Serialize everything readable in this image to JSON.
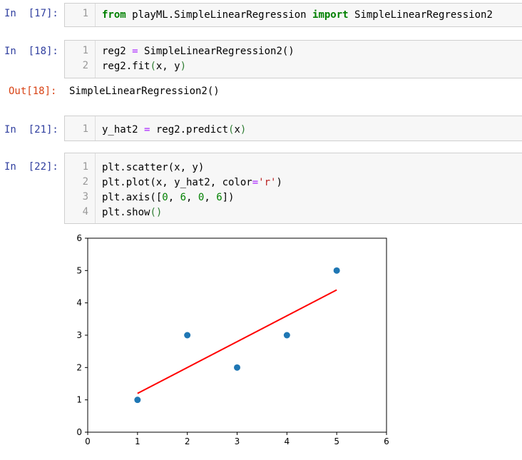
{
  "cells": [
    {
      "prompt": "In  [17]:",
      "lines": [
        {
          "n": "1"
        }
      ]
    },
    {
      "prompt": "In  [18]:",
      "lines": [
        {
          "n": "1"
        },
        {
          "n": "2"
        }
      ]
    },
    {
      "out_prompt": "Out[18]:",
      "out_text": "SimpleLinearRegression2()"
    },
    {
      "prompt": "In  [21]:",
      "lines": [
        {
          "n": "1"
        }
      ]
    },
    {
      "prompt": "In  [22]:",
      "lines": [
        {
          "n": "1"
        },
        {
          "n": "2"
        },
        {
          "n": "3"
        },
        {
          "n": "4"
        }
      ]
    }
  ],
  "code": {
    "c17": {
      "kw_from": "from",
      "module": " playML.SimpleLinearRegression ",
      "kw_import": "import",
      "name": " SimpleLinearRegression2"
    },
    "c18_l1": {
      "lhs": "reg2 ",
      "eq": "=",
      "rhs": " SimpleLinearRegression2()"
    },
    "c18_l2": {
      "text": "reg2.fit",
      "open": "(",
      "args": "x, y",
      "close": ")"
    },
    "c21": {
      "lhs": "y_hat2 ",
      "eq": "=",
      "rhs": " reg2.predict",
      "open": "(",
      "args": "x",
      "close": ")"
    },
    "c22_l1": {
      "text": "plt.scatter(x, y)"
    },
    "c22_l2": {
      "pre": "plt.plot(x, y_hat2, color",
      "eq": "=",
      "str": "'r'",
      "close": ")"
    },
    "c22_l3": {
      "pre": "plt.axis([",
      "n0": "0",
      "c1": ", ",
      "n6a": "6",
      "c2": ", ",
      "n0b": "0",
      "c3": ", ",
      "n6b": "6",
      "post": "])"
    },
    "c22_l4": {
      "pre": "plt.show",
      "open": "(",
      "close": ")"
    }
  },
  "colors": {
    "prompt_in": "#303f9f",
    "prompt_out": "#d84315",
    "scatter": "#1f77b4",
    "line": "#ff0000"
  },
  "chart_data": {
    "type": "scatter",
    "x": [
      1,
      2,
      3,
      4,
      5
    ],
    "y": [
      1,
      3,
      2,
      3,
      5
    ],
    "line": {
      "x": [
        1,
        5
      ],
      "y": [
        1.2,
        4.4
      ],
      "color": "#ff0000"
    },
    "xlim": [
      0,
      6
    ],
    "ylim": [
      0,
      6
    ],
    "xticks": [
      "0",
      "1",
      "2",
      "3",
      "4",
      "5",
      "6"
    ],
    "yticks": [
      "0",
      "1",
      "2",
      "3",
      "4",
      "5",
      "6"
    ],
    "title": "",
    "xlabel": "",
    "ylabel": "",
    "grid": false
  }
}
